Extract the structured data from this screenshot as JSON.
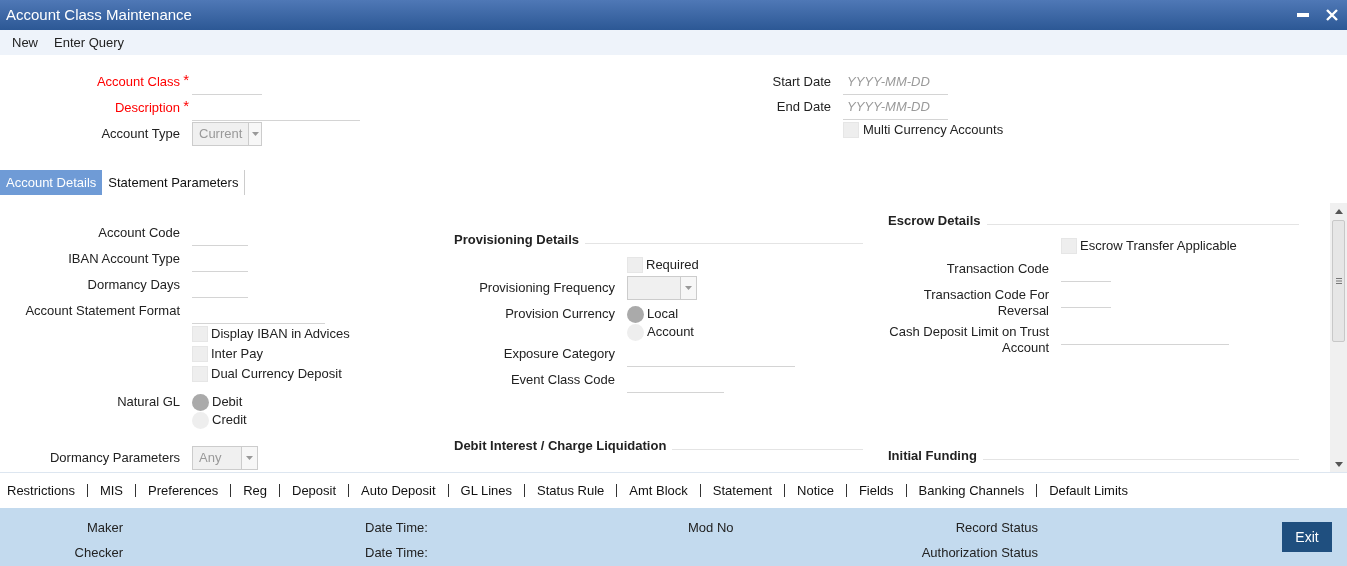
{
  "window": {
    "title": "Account Class Maintenance"
  },
  "menu": [
    {
      "label": "New"
    },
    {
      "label": "Enter Query"
    }
  ],
  "required_mark": "*",
  "header": {
    "left": [
      {
        "kind": "text",
        "label": "Account Class",
        "required": true
      },
      {
        "kind": "text",
        "label": "Description",
        "required": true
      },
      {
        "kind": "select",
        "label": "Account Type",
        "required": false,
        "value": "Current"
      }
    ],
    "right": [
      {
        "kind": "date",
        "label": "Start Date",
        "placeholder": "YYYY-MM-DD"
      },
      {
        "kind": "date",
        "label": "End Date",
        "placeholder": "YYYY-MM-DD"
      },
      {
        "kind": "checkbox",
        "label": "Multi Currency Accounts",
        "checked": false
      }
    ]
  },
  "tabs": [
    {
      "label": "Account Details",
      "selected": true
    },
    {
      "label": "Statement Parameters",
      "selected": false
    }
  ],
  "columns": [
    {
      "sections": [
        {
          "rows": [
            {
              "kind": "text",
              "label": "Account Code"
            },
            {
              "kind": "text",
              "label": "IBAN Account Type"
            },
            {
              "kind": "text",
              "label": "Dormancy Days"
            },
            {
              "kind": "text",
              "label": "Account Statement Format"
            },
            {
              "kind": "checkbox",
              "label": "Display IBAN in Advices",
              "checked": false
            },
            {
              "kind": "checkbox",
              "label": "Inter Pay",
              "checked": false
            },
            {
              "kind": "checkbox",
              "label": "Dual Currency Deposit",
              "checked": false
            },
            {
              "kind": "radio",
              "label": "Natural GL",
              "options": [
                {
                  "label": "Debit",
                  "selected": true
                },
                {
                  "label": "Credit",
                  "selected": false
                }
              ]
            },
            {
              "kind": "select",
              "label": "Dormancy Parameters",
              "value": "Any"
            }
          ]
        }
      ]
    },
    {
      "sections": [
        {
          "title": "Provisioning Details",
          "rows": [
            {
              "kind": "checkbox",
              "label": "Required",
              "checked": false
            },
            {
              "kind": "select",
              "label": "Provisioning Frequency"
            },
            {
              "kind": "radio",
              "label": "Provision Currency",
              "options": [
                {
                  "label": "Local",
                  "selected": true
                },
                {
                  "label": "Account",
                  "selected": false
                }
              ]
            },
            {
              "kind": "text",
              "label": "Exposure Category"
            },
            {
              "kind": "text",
              "label": "Event Class Code"
            }
          ]
        },
        {
          "title": "Debit Interest / Charge Liquidation"
        }
      ]
    },
    {
      "sections": [
        {
          "title": "Escrow Details",
          "rows": [
            {
              "kind": "checkbox",
              "label": "Escrow Transfer Applicable",
              "checked": false
            },
            {
              "kind": "text",
              "label": "Transaction Code"
            },
            {
              "kind": "text",
              "label": "Transaction Code For Reversal"
            },
            {
              "kind": "text",
              "label": "Cash Deposit Limit on Trust Account"
            }
          ]
        },
        {
          "title": "Initial Funding"
        }
      ]
    }
  ],
  "subscreens": [
    {
      "label": "Restrictions"
    },
    {
      "label": "MIS"
    },
    {
      "label": "Preferences"
    },
    {
      "label": "Reg"
    },
    {
      "label": "Deposit"
    },
    {
      "label": "Auto Deposit"
    },
    {
      "label": "GL Lines"
    },
    {
      "label": "Status Rule"
    },
    {
      "label": "Amt Block"
    },
    {
      "label": "Statement"
    },
    {
      "label": "Notice"
    },
    {
      "label": "Fields"
    },
    {
      "label": "Banking Channels"
    },
    {
      "label": "Default Limits"
    }
  ],
  "footer": {
    "columns": [
      {
        "items": [
          "Maker",
          "Checker"
        ]
      },
      {
        "items": [
          "Date Time:",
          "Date Time:"
        ]
      },
      {
        "items": [
          "Mod No"
        ]
      },
      {
        "items": [
          "Record Status",
          "Authorization Status"
        ]
      }
    ],
    "button": "Exit"
  }
}
